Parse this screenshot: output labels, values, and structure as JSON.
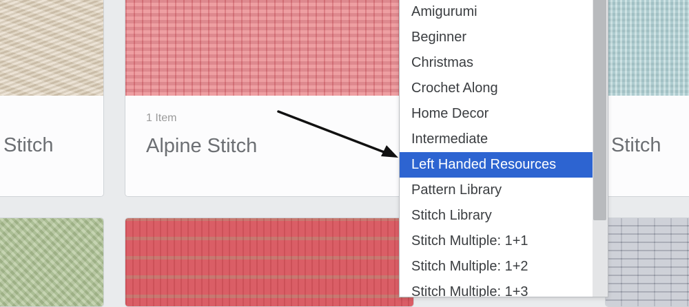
{
  "cards": {
    "left_top": {
      "title": "Stitch"
    },
    "center_top": {
      "count": "1 Item",
      "title": "Alpine Stitch"
    },
    "right_top": {
      "title": "Stitch"
    }
  },
  "dropdown": {
    "options": [
      "Amigurumi",
      "Beginner",
      "Christmas",
      "Crochet Along",
      "Home Decor",
      "Intermediate",
      "Left Handed Resources",
      "Pattern Library",
      "Stitch Library",
      "Stitch Multiple: 1+1",
      "Stitch Multiple: 1+2",
      "Stitch Multiple: 1+3"
    ],
    "selected": "Left Handed Resources"
  },
  "colors": {
    "selected_bg": "#2d64d1",
    "annotation_arrow": "#111111"
  }
}
